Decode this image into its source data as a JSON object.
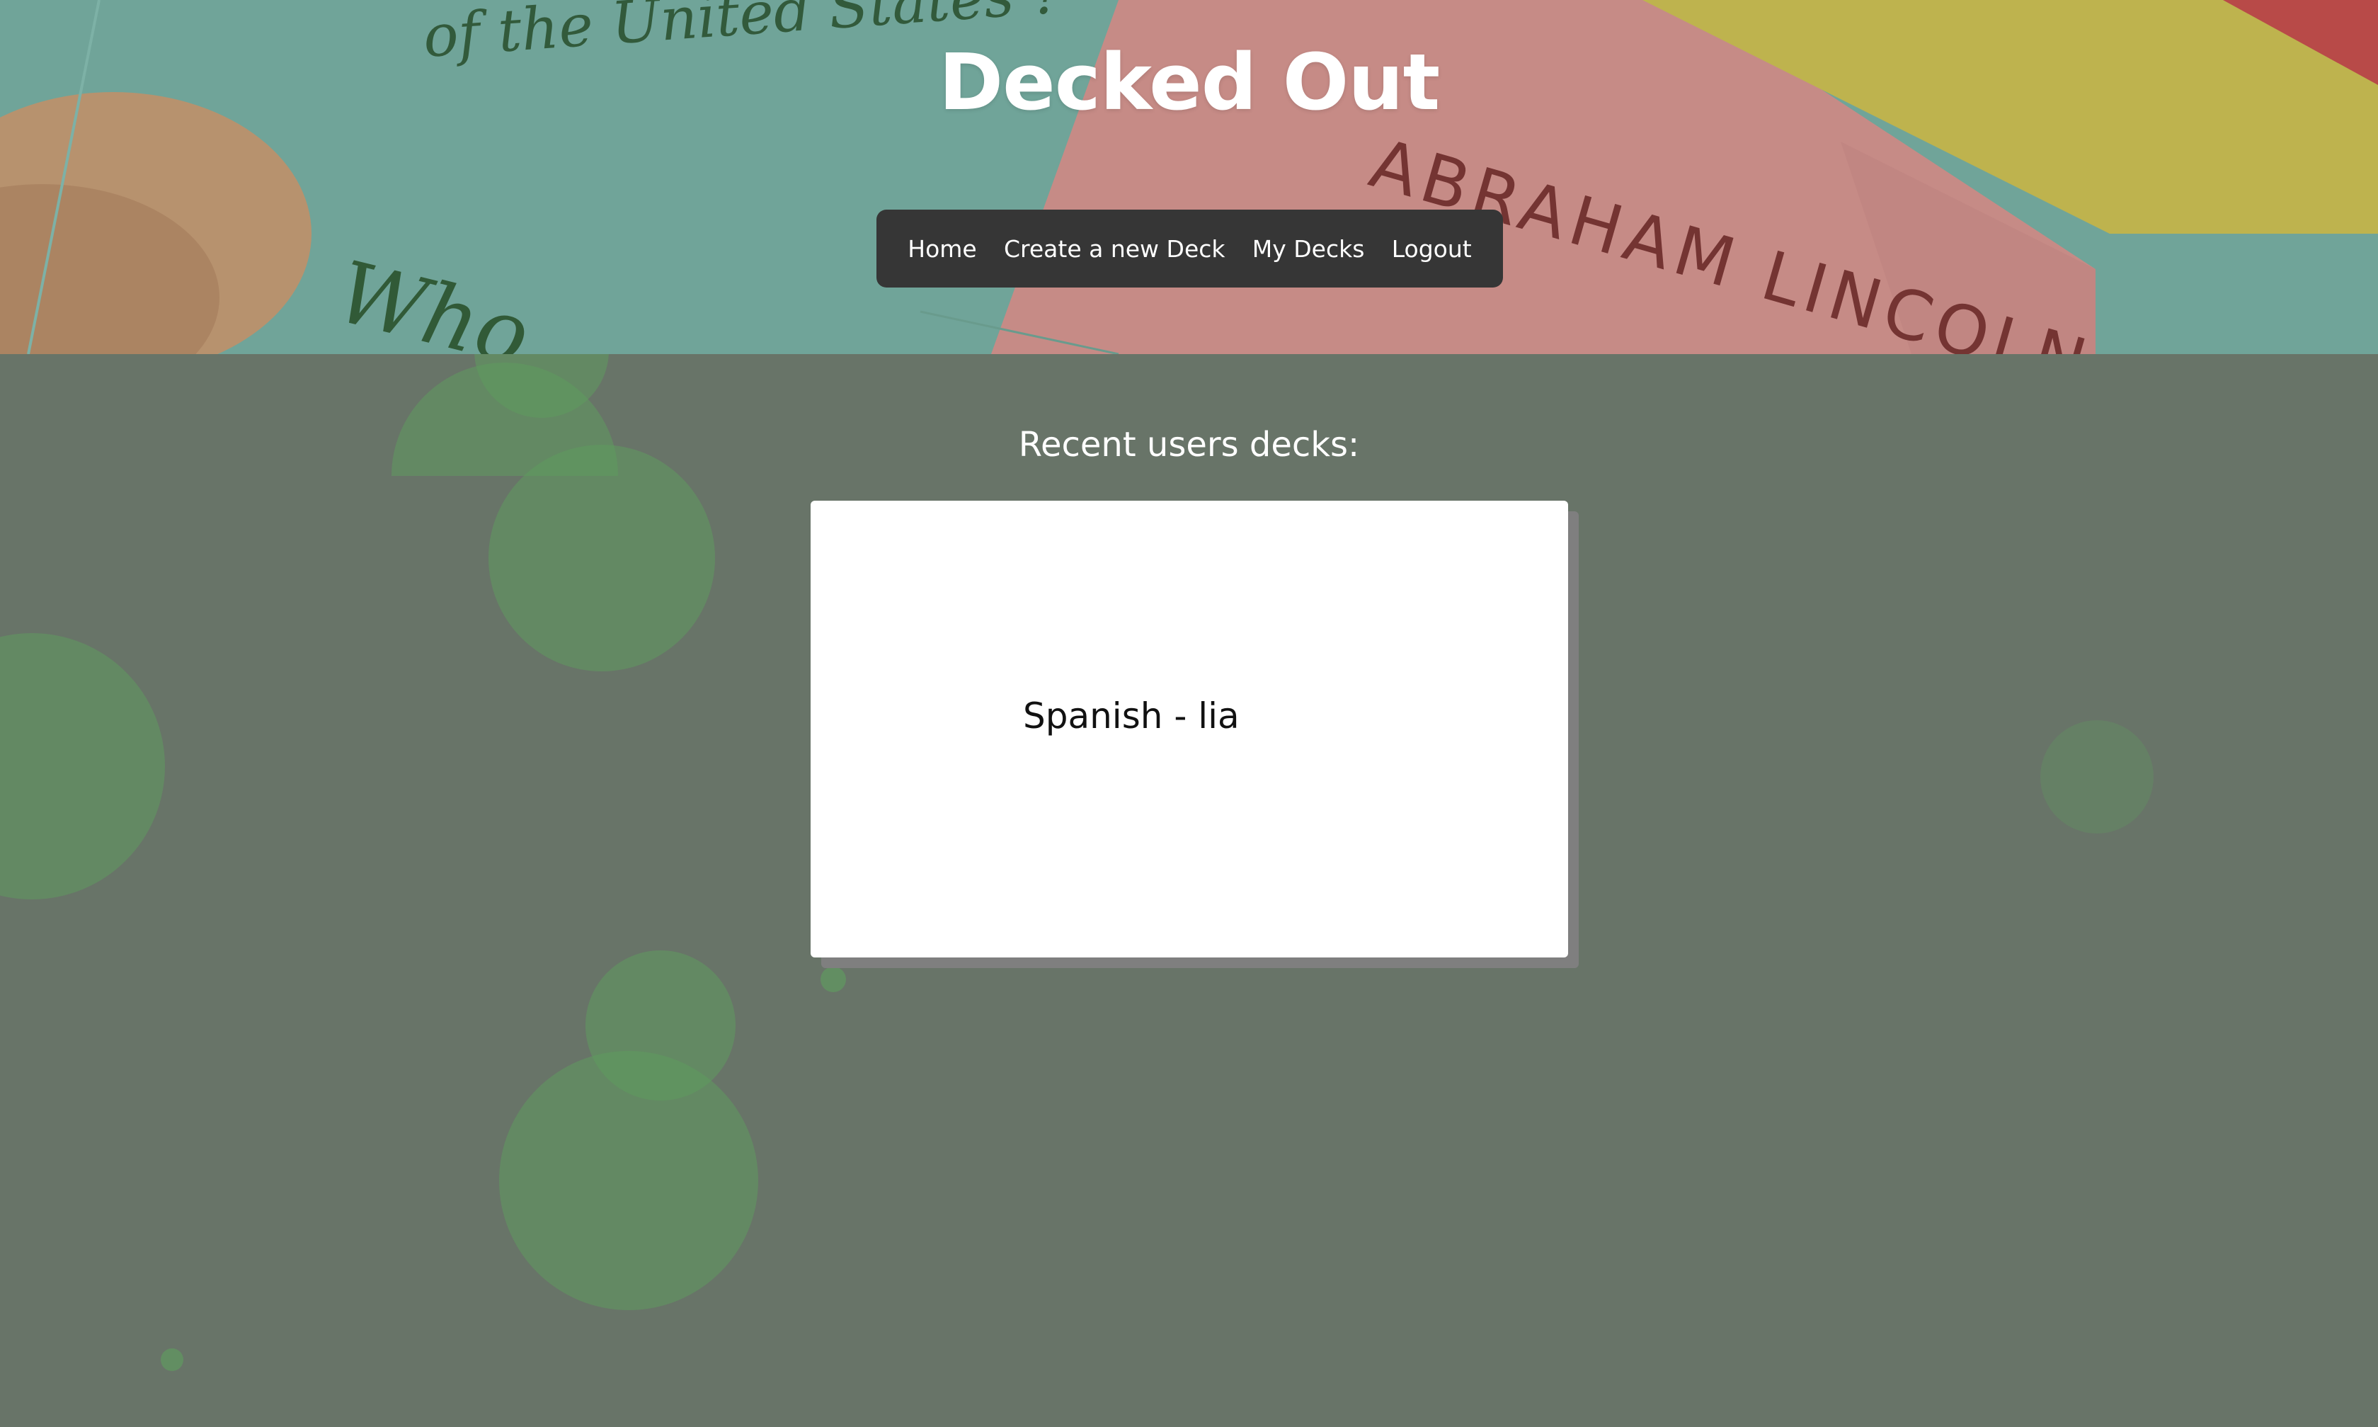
{
  "header": {
    "title": "Decked Out",
    "background_card_text": {
      "line1": "of the United States ?",
      "line2": "Who",
      "answer": "ABRAHAM LINCOLN"
    }
  },
  "nav": {
    "items": [
      {
        "label": "Home"
      },
      {
        "label": "Create a new Deck"
      },
      {
        "label": "My Decks"
      },
      {
        "label": "Logout"
      }
    ]
  },
  "main": {
    "heading": "Recent users decks:",
    "decks": [
      {
        "title": "Spanish - lia"
      }
    ]
  },
  "colors": {
    "page_background": "#687468",
    "navbar_background": "#363636",
    "bubble": "#5f9a5f",
    "card_shadow": "#7f7f7f"
  }
}
